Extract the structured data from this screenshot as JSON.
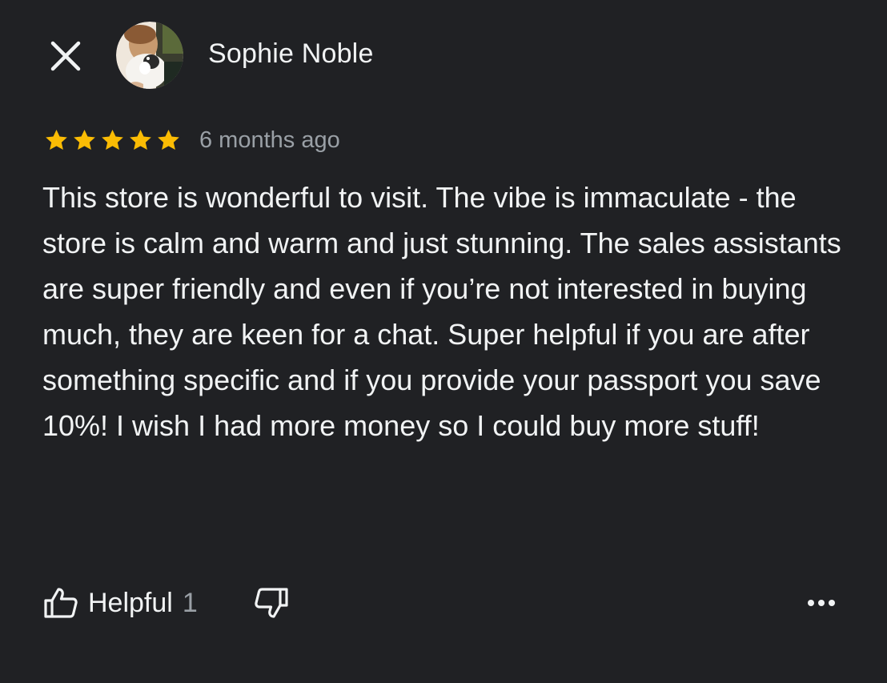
{
  "header": {
    "close_icon": "close-icon",
    "author_name": "Sophie Noble",
    "avatar_icon": "profile-photo"
  },
  "review": {
    "rating": 5,
    "rating_max": 5,
    "star_color": "#fbbc04",
    "time_ago": "6 months ago",
    "text": "This store is wonderful to visit. The vibe is immaculate - the store is calm and warm and just stunning. The sales assistants are super friendly and even if you’re not interested in buying much, they are keen for a chat. Super helpful if you are after something specific and if you provide your passport you save 10%! I wish I had more money so I could buy more stuff!"
  },
  "actions": {
    "helpful_label": "Helpful",
    "helpful_count": "1",
    "like_icon": "thumbs-up-icon",
    "dislike_icon": "thumbs-down-icon",
    "more_icon": "more-horizontal-icon"
  },
  "colors": {
    "background": "#202124",
    "text_primary": "#f1f3f4",
    "text_secondary": "#9aa0a6"
  }
}
